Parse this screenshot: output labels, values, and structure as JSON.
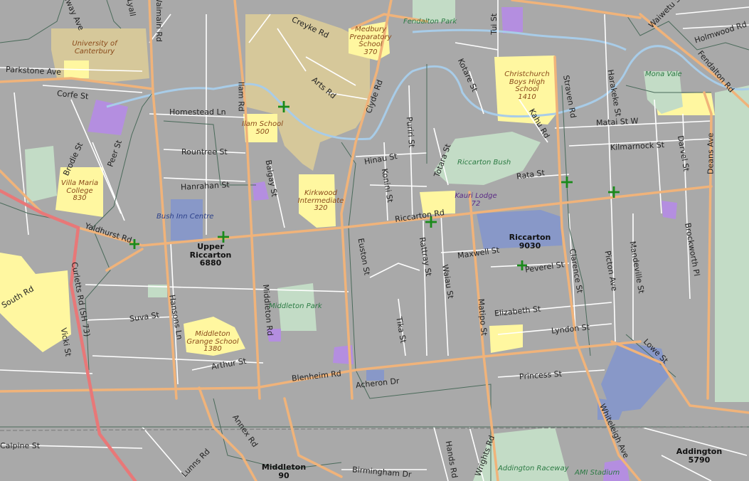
{
  "colors": {
    "background": "#a9a9a9",
    "main_road": "#f0b37a",
    "minor_road": "#ffffff",
    "highway": "#e87878",
    "river": "#a8cce8",
    "boundary": "#4a6a5a",
    "school": "#fff7a0",
    "university": "#d6c89a",
    "park": "#c3dcc6",
    "retail": "#8898c8",
    "church": "#b48ee0",
    "railway": "#888888"
  },
  "streets": [
    "Solway Ave",
    "Waimairi Rd",
    "Creyke Rd",
    "Tui St",
    "Waiwetu St",
    "Holmwood Rd",
    "Parkstone Ave",
    "Corfe St",
    "Homestead Ln",
    "Ilam Rd",
    "Arts Rd",
    "Clyde Rd",
    "Kotare St",
    "Straven Rd",
    "Harakeke St",
    "Fendalton Rd",
    "Matai St W",
    "Rountree St",
    "Kahu Rd",
    "Kilmarnock St",
    "Brodie St",
    "Peer St",
    "Balgay St",
    "Hinau St",
    "Konini St",
    "Puriri St",
    "Totara St",
    "Rata St",
    "Hanrahan St",
    "Darvel St",
    "Deans Ave",
    "Yaldhurst Rd",
    "Riccarton Rd",
    "Euston St",
    "Rattray St",
    "Waiau St",
    "Maxwell St",
    "Peverel St",
    "Clarence St",
    "Picton Ave",
    "Mandeville St",
    "Brockworth Pl",
    "Curletts Rd (SH 73)",
    "Hansons Ln",
    "Middleton Rd",
    "Whiteleigh Ave",
    "Suva St",
    "Tika St",
    "Matipo St",
    "Elizabeth St",
    "Lyndon St",
    "Vicki St",
    "Arthur St",
    "Blenheim Rd",
    "Acheron Dr",
    "Princess St",
    "Lowe St",
    "Annex Rd",
    "Lunns Rd",
    "Birmingham Dr",
    "Hands Rd",
    "Wrights Rd",
    "Calpine St",
    "South Rd",
    "Lyall"
  ],
  "schools": [
    {
      "name": "University of Canterbury"
    },
    {
      "name": "Medbury Preparatory School",
      "roll": "370"
    },
    {
      "name": "Christchurch Boys High School",
      "roll": "1410"
    },
    {
      "name": "Ilam School",
      "roll": "500"
    },
    {
      "name": "Villa Maria College",
      "roll": "830"
    },
    {
      "name": "Kirkwood Intermediate",
      "roll": "320"
    },
    {
      "name": "Middleton Grange School",
      "roll": "1380"
    }
  ],
  "parks": [
    "Fendalton Park",
    "Mona Vale",
    "Riccarton Bush",
    "Middleton Park",
    "Addington Raceway",
    "AMI Stadium"
  ],
  "places": [
    "Bush Inn Centre",
    "Kauri Lodge"
  ],
  "kauri_lodge_roll": "72",
  "suburbs": [
    {
      "name": "Upper Riccarton",
      "population": "6880"
    },
    {
      "name": "Riccarton",
      "population": "9030"
    },
    {
      "name": "Middleton",
      "population": "90"
    },
    {
      "name": "Addington",
      "population": "5790"
    }
  ]
}
